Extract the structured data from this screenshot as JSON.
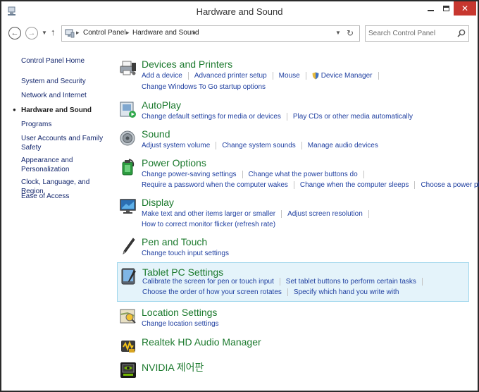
{
  "window": {
    "title": "Hardware and Sound"
  },
  "address": {
    "crumbs": [
      "Control Panel",
      "Hardware and Sound"
    ]
  },
  "search": {
    "placeholder": "Search Control Panel"
  },
  "sidebar": {
    "items": [
      {
        "label": "Control Panel Home"
      },
      {
        "label": "System and Security"
      },
      {
        "label": "Network and Internet"
      },
      {
        "label": "Hardware and Sound"
      },
      {
        "label": "Programs"
      },
      {
        "label": "User Accounts and Family Safety"
      },
      {
        "label": "Appearance and Personalization"
      },
      {
        "label": "Clock, Language, and Region"
      },
      {
        "label": "Ease of Access"
      }
    ]
  },
  "sections": [
    {
      "title": "Devices and Printers",
      "icon": "printer-icon",
      "rows": [
        [
          "Add a device",
          "Advanced printer setup",
          "Mouse",
          "Device Manager"
        ],
        [
          "Change Windows To Go startup options"
        ]
      ]
    },
    {
      "title": "AutoPlay",
      "icon": "autoplay-icon",
      "rows": [
        [
          "Change default settings for media or devices",
          "Play CDs or other media automatically"
        ]
      ]
    },
    {
      "title": "Sound",
      "icon": "speaker-icon",
      "rows": [
        [
          "Adjust system volume",
          "Change system sounds",
          "Manage audio devices"
        ]
      ]
    },
    {
      "title": "Power Options",
      "icon": "battery-icon",
      "rows": [
        [
          "Change power-saving settings",
          "Change what the power buttons do"
        ],
        [
          "Require a password when the computer wakes",
          "Change when the computer sleeps",
          "Choose a power plan"
        ]
      ]
    },
    {
      "title": "Display",
      "icon": "monitor-icon",
      "rows": [
        [
          "Make text and other items larger or smaller",
          "Adjust screen resolution"
        ],
        [
          "How to correct monitor flicker (refresh rate)"
        ]
      ]
    },
    {
      "title": "Pen and Touch",
      "icon": "pen-icon",
      "rows": [
        [
          "Change touch input settings"
        ]
      ]
    },
    {
      "title": "Tablet PC Settings",
      "icon": "tablet-icon",
      "rows": [
        [
          "Calibrate the screen for pen or touch input",
          "Set tablet buttons to perform certain tasks"
        ],
        [
          "Choose the order of how your screen rotates",
          "Specify which hand you write with"
        ]
      ]
    },
    {
      "title": "Location Settings",
      "icon": "location-icon",
      "rows": [
        [
          "Change location settings"
        ]
      ]
    },
    {
      "title": "Realtek HD Audio Manager",
      "icon": "realtek-audio-icon",
      "rows": []
    },
    {
      "title": "NVIDIA 제어판",
      "icon": "nvidia-icon",
      "rows": []
    }
  ],
  "colors": {
    "title_green": "#1c7a2e",
    "link_blue": "#1f3fa0",
    "close_red": "#c7372f",
    "highlight_bg": "#e4f3fa"
  }
}
